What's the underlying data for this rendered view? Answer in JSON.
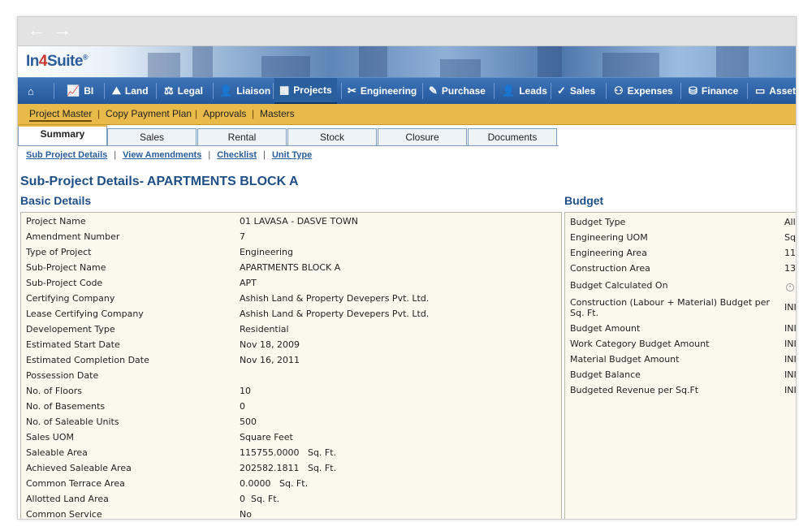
{
  "browser": {
    "back_label": "←",
    "forward_label": "→"
  },
  "logo": {
    "pre": "In",
    "four": "4",
    "post": "Suite",
    "mark": "®"
  },
  "menu": [
    {
      "name": "home",
      "label": "",
      "icon": "home-icon",
      "glyph": "⌂"
    },
    {
      "name": "bi",
      "label": "BI",
      "icon": "chart-icon",
      "glyph": "📈"
    },
    {
      "name": "land",
      "label": "Land",
      "icon": "land-icon",
      "glyph": "⛰"
    },
    {
      "name": "legal",
      "label": "Legal",
      "icon": "scales-icon",
      "glyph": "⚖"
    },
    {
      "name": "liaison",
      "label": "Liaison",
      "icon": "user-icon",
      "glyph": "👤"
    },
    {
      "name": "projects",
      "label": "Projects",
      "icon": "building-icon",
      "glyph": "▦"
    },
    {
      "name": "engineering",
      "label": "Engineering",
      "icon": "tools-icon",
      "glyph": "✂"
    },
    {
      "name": "purchase",
      "label": "Purchase",
      "icon": "pen-icon",
      "glyph": "✎"
    },
    {
      "name": "leads",
      "label": "Leads",
      "icon": "user-icon",
      "glyph": "👤"
    },
    {
      "name": "sales",
      "label": "Sales",
      "icon": "tag-icon",
      "glyph": "✓"
    },
    {
      "name": "expenses",
      "label": "Expenses",
      "icon": "people-icon",
      "glyph": "⚇"
    },
    {
      "name": "finance",
      "label": "Finance",
      "icon": "coins-icon",
      "glyph": "⛁"
    },
    {
      "name": "asset",
      "label": "Asset",
      "icon": "monitor-icon",
      "glyph": "▭"
    }
  ],
  "submenu": [
    "Project Master",
    "Copy Payment Plan",
    "Approvals",
    "Masters"
  ],
  "tabs": [
    "Summary",
    "Sales",
    "Rental",
    "Stock",
    "Closure",
    "Documents"
  ],
  "links": [
    "Sub Project Details",
    "View Amendments",
    "Checklist",
    "Unit Type"
  ],
  "page_title": "Sub-Project Details- APARTMENTS BLOCK A",
  "basic": {
    "title": "Basic Details",
    "rows": [
      {
        "label": "Project Name",
        "value": "01 LAVASA - DASVE TOWN"
      },
      {
        "label": "Amendment Number",
        "value": "7"
      },
      {
        "label": "Type of Project",
        "value": "Engineering"
      },
      {
        "label": "Sub-Project Name",
        "value": "APARTMENTS BLOCK A"
      },
      {
        "label": "Sub-Project Code",
        "value": "APT"
      },
      {
        "label": "Certifying Company",
        "value": "Ashish Land & Property Devepers Pvt. Ltd."
      },
      {
        "label": "Lease Certifying Company",
        "value": "Ashish Land & Property Devepers Pvt. Ltd."
      },
      {
        "label": "Developement Type",
        "value": "Residential"
      },
      {
        "label": "Estimated Start Date",
        "value": "Nov 18, 2009"
      },
      {
        "label": "Estimated Completion Date",
        "value": "Nov 16, 2011"
      },
      {
        "label": "Possession Date",
        "value": ""
      },
      {
        "label": "No. of Floors",
        "value": "10"
      },
      {
        "label": "No. of Basements",
        "value": "0"
      },
      {
        "label": "No. of Saleable Units",
        "value": "500"
      },
      {
        "label": "Sales UOM",
        "value": "Square Feet"
      },
      {
        "label": "Saleable Area",
        "value": "115755.0000   Sq. Ft."
      },
      {
        "label": "Achieved Saleable Area",
        "value": "202582.1811   Sq. Ft."
      },
      {
        "label": "Common Terrace Area",
        "value": "0.0000   Sq. Ft."
      },
      {
        "label": "Allotted Land Area",
        "value": "0  Sq. Ft."
      },
      {
        "label": "Common Service",
        "value": "No"
      }
    ]
  },
  "budget": {
    "title": "Budget",
    "rows": [
      {
        "label": "Budget Type",
        "value": "All"
      },
      {
        "label": "Engineering UOM",
        "value": "Sq"
      },
      {
        "label": "Engineering Area",
        "value": "11"
      },
      {
        "label": "Construction Area",
        "value": "13"
      },
      {
        "label": "Budget Calculated On",
        "value": ""
      },
      {
        "label": "Construction (Labour + Material) Budget per Sq. Ft.",
        "value": "INI"
      },
      {
        "label": "Budget Amount",
        "value": "INI"
      },
      {
        "label": "Work Category Budget Amount",
        "value": "INI"
      },
      {
        "label": "Material Budget Amount",
        "value": "INI"
      },
      {
        "label": "Budget Balance",
        "value": "INI"
      },
      {
        "label": "Budgeted Revenue per Sq.Ft",
        "value": "INI"
      }
    ]
  },
  "colors": {
    "menu": "#2b62a6",
    "submenu": "#e8ba4a",
    "title": "#1f4f87",
    "panel": "#fbf9ee"
  }
}
